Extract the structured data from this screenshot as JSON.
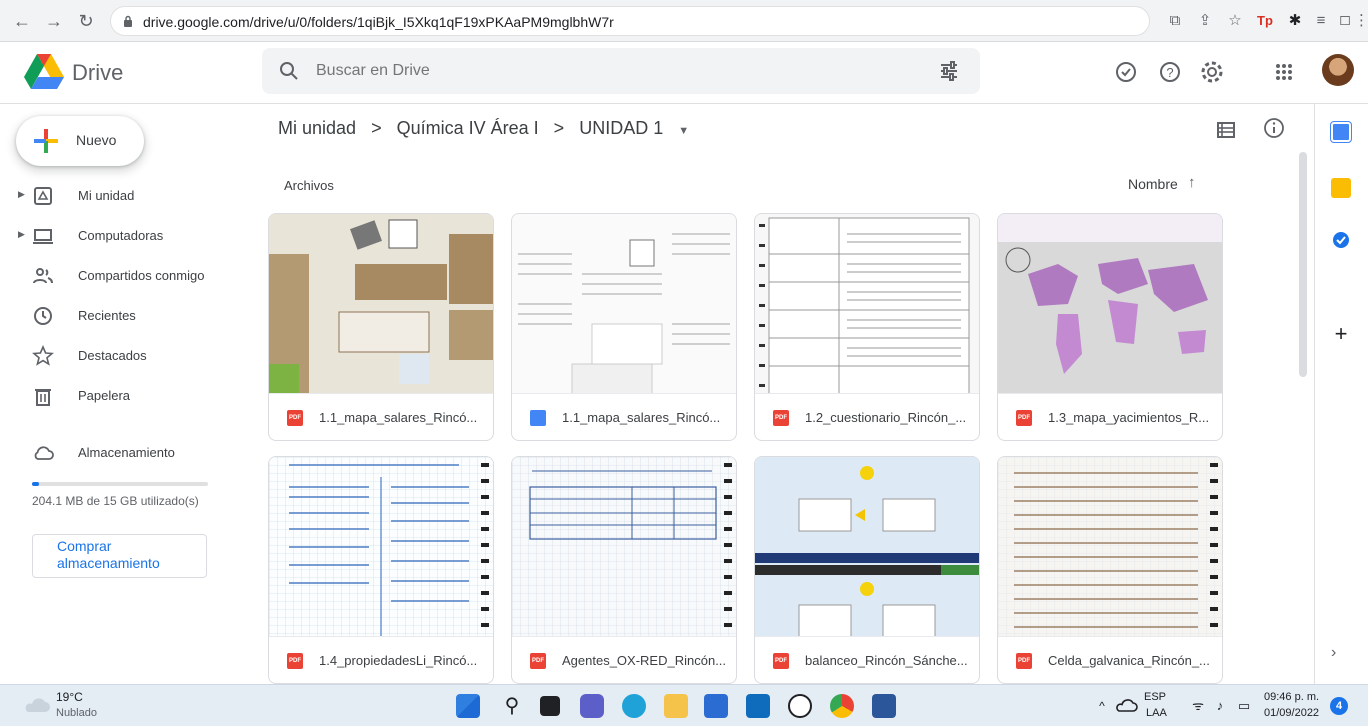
{
  "browser": {
    "url": "drive.google.com/drive/u/0/folders/1qiBjk_I5Xkq1qF19xPKAaPM9mglbhW7r"
  },
  "header": {
    "app_name": "Drive",
    "search_placeholder": "Buscar en Drive"
  },
  "sidebar": {
    "new_label": "Nuevo",
    "items": [
      {
        "label": "Mi unidad",
        "icon": "drive-icon",
        "expandable": true
      },
      {
        "label": "Computadoras",
        "icon": "computer-icon",
        "expandable": true
      },
      {
        "label": "Compartidos conmigo",
        "icon": "people-icon",
        "expandable": false
      },
      {
        "label": "Recientes",
        "icon": "clock-icon",
        "expandable": false
      },
      {
        "label": "Destacados",
        "icon": "star-icon",
        "expandable": false
      },
      {
        "label": "Papelera",
        "icon": "trash-icon",
        "expandable": false
      }
    ],
    "storage_label": "Almacenamiento",
    "storage_text": "204.1 MB de 15 GB utilizado(s)",
    "storage_fraction": 0.014,
    "buy_label": "Comprar almacenamiento"
  },
  "breadcrumb": {
    "items": [
      "Mi unidad",
      "Química IV Área I",
      "UNIDAD 1"
    ],
    "separator": ">"
  },
  "main": {
    "section_label": "Archivos",
    "sort_label": "Nombre",
    "sort_arrow": "↑",
    "files": [
      {
        "name": "1.1_mapa_salares_Rincó...",
        "type": "pdf"
      },
      {
        "name": "1.1_mapa_salares_Rincó...",
        "type": "doc"
      },
      {
        "name": "1.2_cuestionario_Rincón_...",
        "type": "pdf"
      },
      {
        "name": "1.3_mapa_yacimientos_R...",
        "type": "pdf"
      },
      {
        "name": "1.4_propiedadesLi_Rincó...",
        "type": "pdf"
      },
      {
        "name": "Agentes_OX-RED_Rincón...",
        "type": "pdf"
      },
      {
        "name": "balanceo_Rincón_Sánche...",
        "type": "pdf"
      },
      {
        "name": "Celda_galvanica_Rincón_...",
        "type": "pdf"
      }
    ],
    "pdf_badge": "PDF"
  },
  "taskbar": {
    "temperature": "19°C",
    "weather": "Nublado",
    "lang1": "ESP",
    "lang2": "LAA",
    "time": "09:46 p. m.",
    "date": "01/09/2022",
    "notifications": "4"
  },
  "colors": {
    "accent": "#1a73e8",
    "pdf": "#ea4335",
    "doc": "#4285f4"
  }
}
